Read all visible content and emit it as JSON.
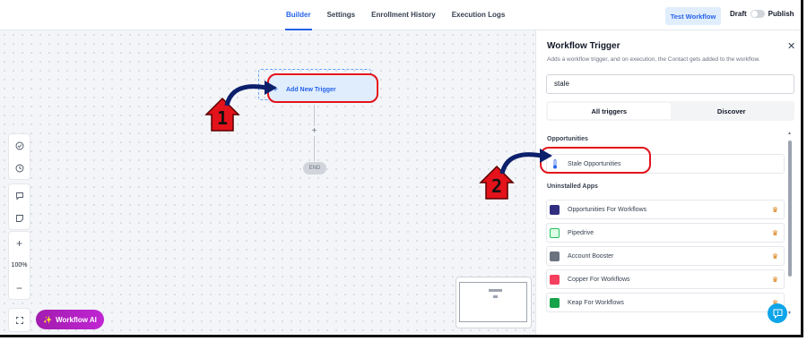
{
  "topbar": {
    "tabs": [
      {
        "label": "Builder",
        "active": true
      },
      {
        "label": "Settings",
        "active": false
      },
      {
        "label": "Enrollment History",
        "active": false
      },
      {
        "label": "Execution Logs",
        "active": false
      }
    ],
    "test_button": "Test Workflow",
    "draft_label": "Draft",
    "publish_label": "Publish",
    "publish_toggle_on": false
  },
  "canvas": {
    "trigger_node_label": "Add New Trigger",
    "end_label": "END",
    "zoom_level": "100%",
    "workflow_ai_label": "Workflow AI"
  },
  "panel": {
    "title": "Workflow Trigger",
    "description": "Adds a workflow trigger, and on execution, the Contact gets added to the workflow.",
    "search_value": "stale",
    "toggle_options": [
      "All triggers",
      "Discover"
    ],
    "selected_toggle": "All triggers",
    "section_opportunities": "Opportunities",
    "opportunity_items": [
      {
        "label": "Stale Opportunities",
        "icon": "thermometer-icon"
      }
    ],
    "section_uninstalled": "Uninstalled Apps",
    "uninstalled_items": [
      {
        "label": "Opportunities For Workflows",
        "color": "#312e81"
      },
      {
        "label": "Pipedrive",
        "color": "#22c55e"
      },
      {
        "label": "Account Booster",
        "color": "#6b7280"
      },
      {
        "label": "Copper For Workflows",
        "color": "#f43f5e"
      },
      {
        "label": "Keap For Workflows",
        "color": "#16a34a"
      }
    ]
  },
  "annotations": {
    "step1": "1",
    "step2": "2",
    "highlight_color": "#e3121b",
    "arrow_color": "#0b1f6b"
  },
  "colors": {
    "accent": "#2563eb",
    "ai_button": "#c026d3",
    "help": "#0ea5e9"
  }
}
